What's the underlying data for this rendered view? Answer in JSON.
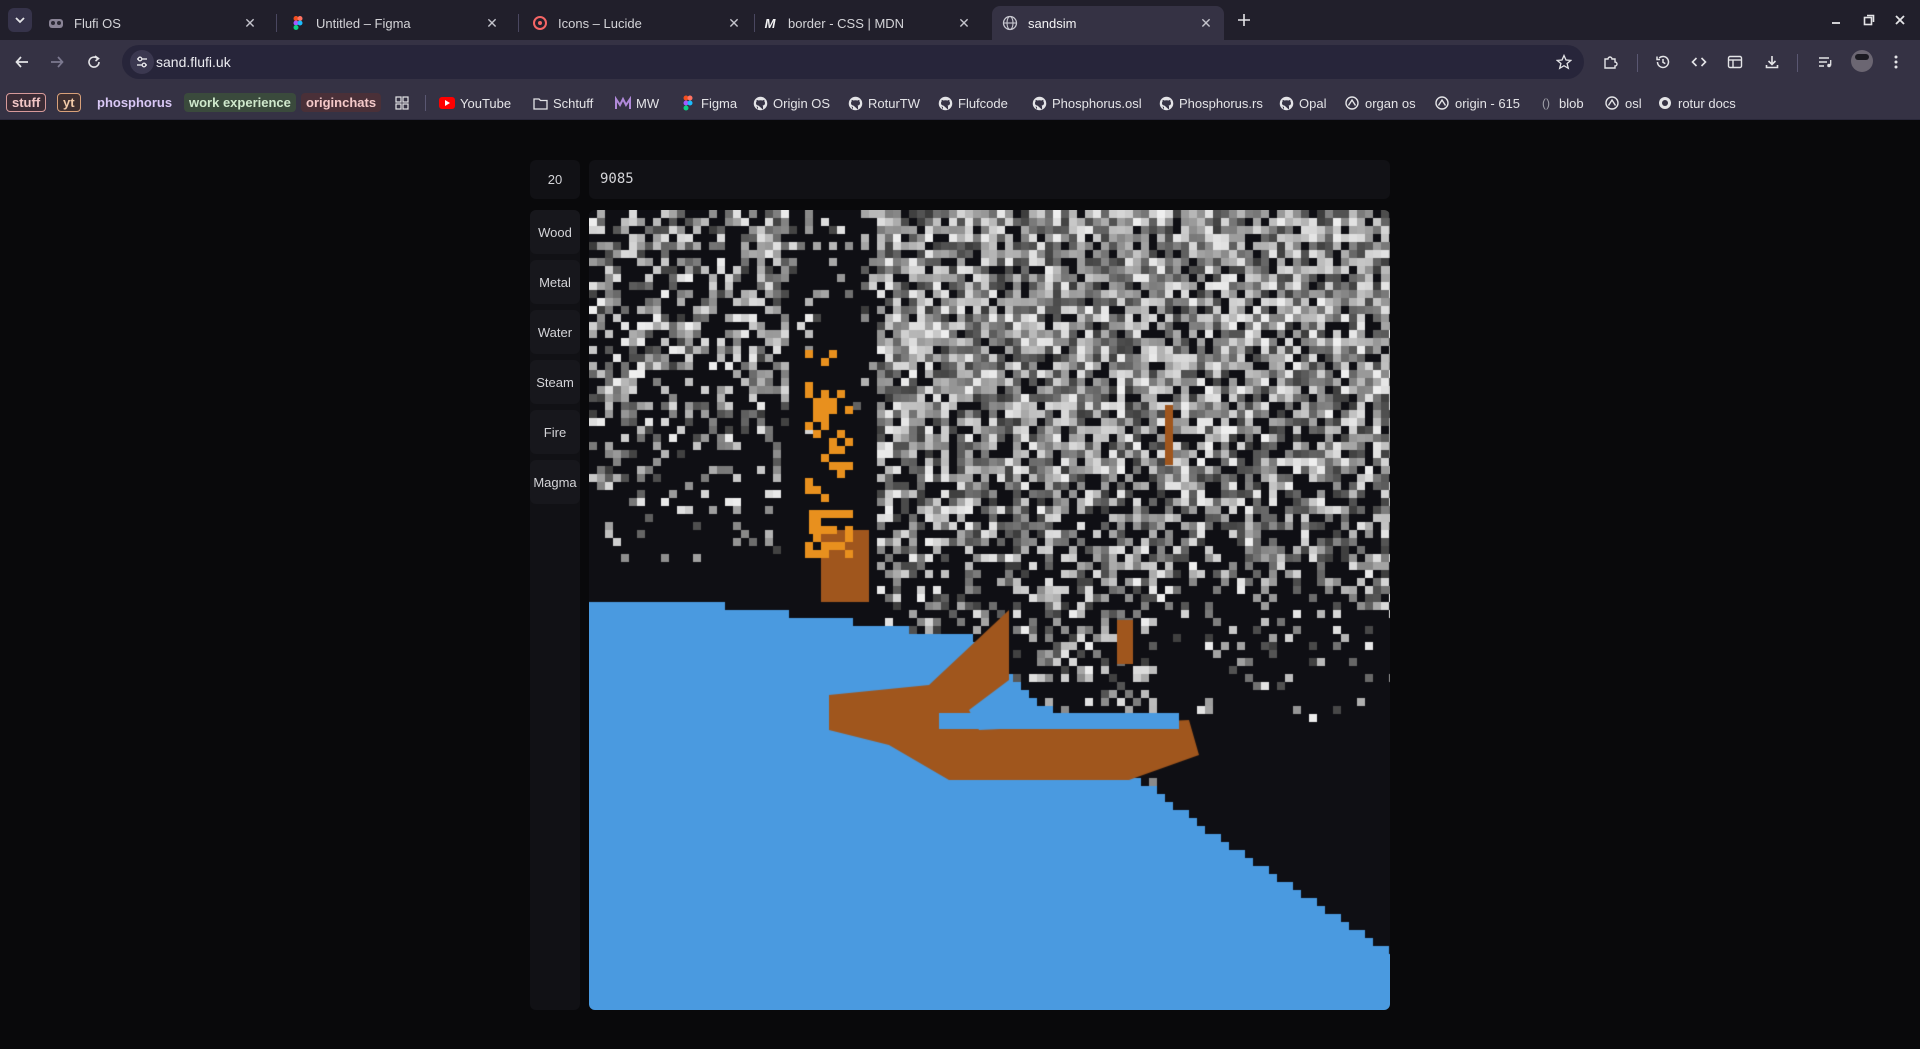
{
  "browser": {
    "tabs": [
      {
        "title": "Flufi OS",
        "icon": "flufi-os-icon",
        "active": false
      },
      {
        "title": "Untitled – Figma",
        "icon": "figma-icon",
        "active": false
      },
      {
        "title": "Icons – Lucide",
        "icon": "lucide-icon",
        "active": false
      },
      {
        "title": "border - CSS | MDN",
        "icon": "mdn-icon",
        "active": false
      },
      {
        "title": "sandsim",
        "icon": "globe-icon",
        "active": true
      }
    ],
    "url": "sand.flufi.uk",
    "bookmarks": {
      "chips": [
        "stuff",
        "yt",
        "phosphorus",
        "work experience",
        "originchats"
      ],
      "links": [
        {
          "label": "YouTube",
          "icon": "youtube-icon"
        },
        {
          "label": "Schtuff",
          "icon": "folder-icon"
        },
        {
          "label": "MW",
          "icon": "mw-icon"
        },
        {
          "label": "Figma",
          "icon": "figma-icon"
        },
        {
          "label": "Origin OS",
          "icon": "github-icon"
        },
        {
          "label": "RoturTW",
          "icon": "github-icon"
        },
        {
          "label": "Flufcode",
          "icon": "github-icon"
        },
        {
          "label": "Phosphorus.osl",
          "icon": "github-icon"
        },
        {
          "label": "Phosphorus.rs",
          "icon": "github-icon"
        },
        {
          "label": "Opal",
          "icon": "github-icon"
        },
        {
          "label": "organ os",
          "icon": "rotur-icon"
        },
        {
          "label": "origin - 615",
          "icon": "rotur-icon"
        },
        {
          "label": "blob",
          "icon": "blob-icon"
        },
        {
          "label": "osl",
          "icon": "rotur-icon"
        },
        {
          "label": "rotur docs",
          "icon": "rotur-docs-icon"
        }
      ]
    }
  },
  "app": {
    "brush_size": "20",
    "particle_count": "9085",
    "materials": [
      "Wood",
      "Metal",
      "Water",
      "Steam",
      "Fire",
      "Magma"
    ]
  },
  "colors": {
    "background": "#09090b",
    "panel": "#111115",
    "water": "#4a9ae0",
    "wood": "#a0561d",
    "fire": "#e8901e",
    "steam_light": "#e6e6e6"
  }
}
